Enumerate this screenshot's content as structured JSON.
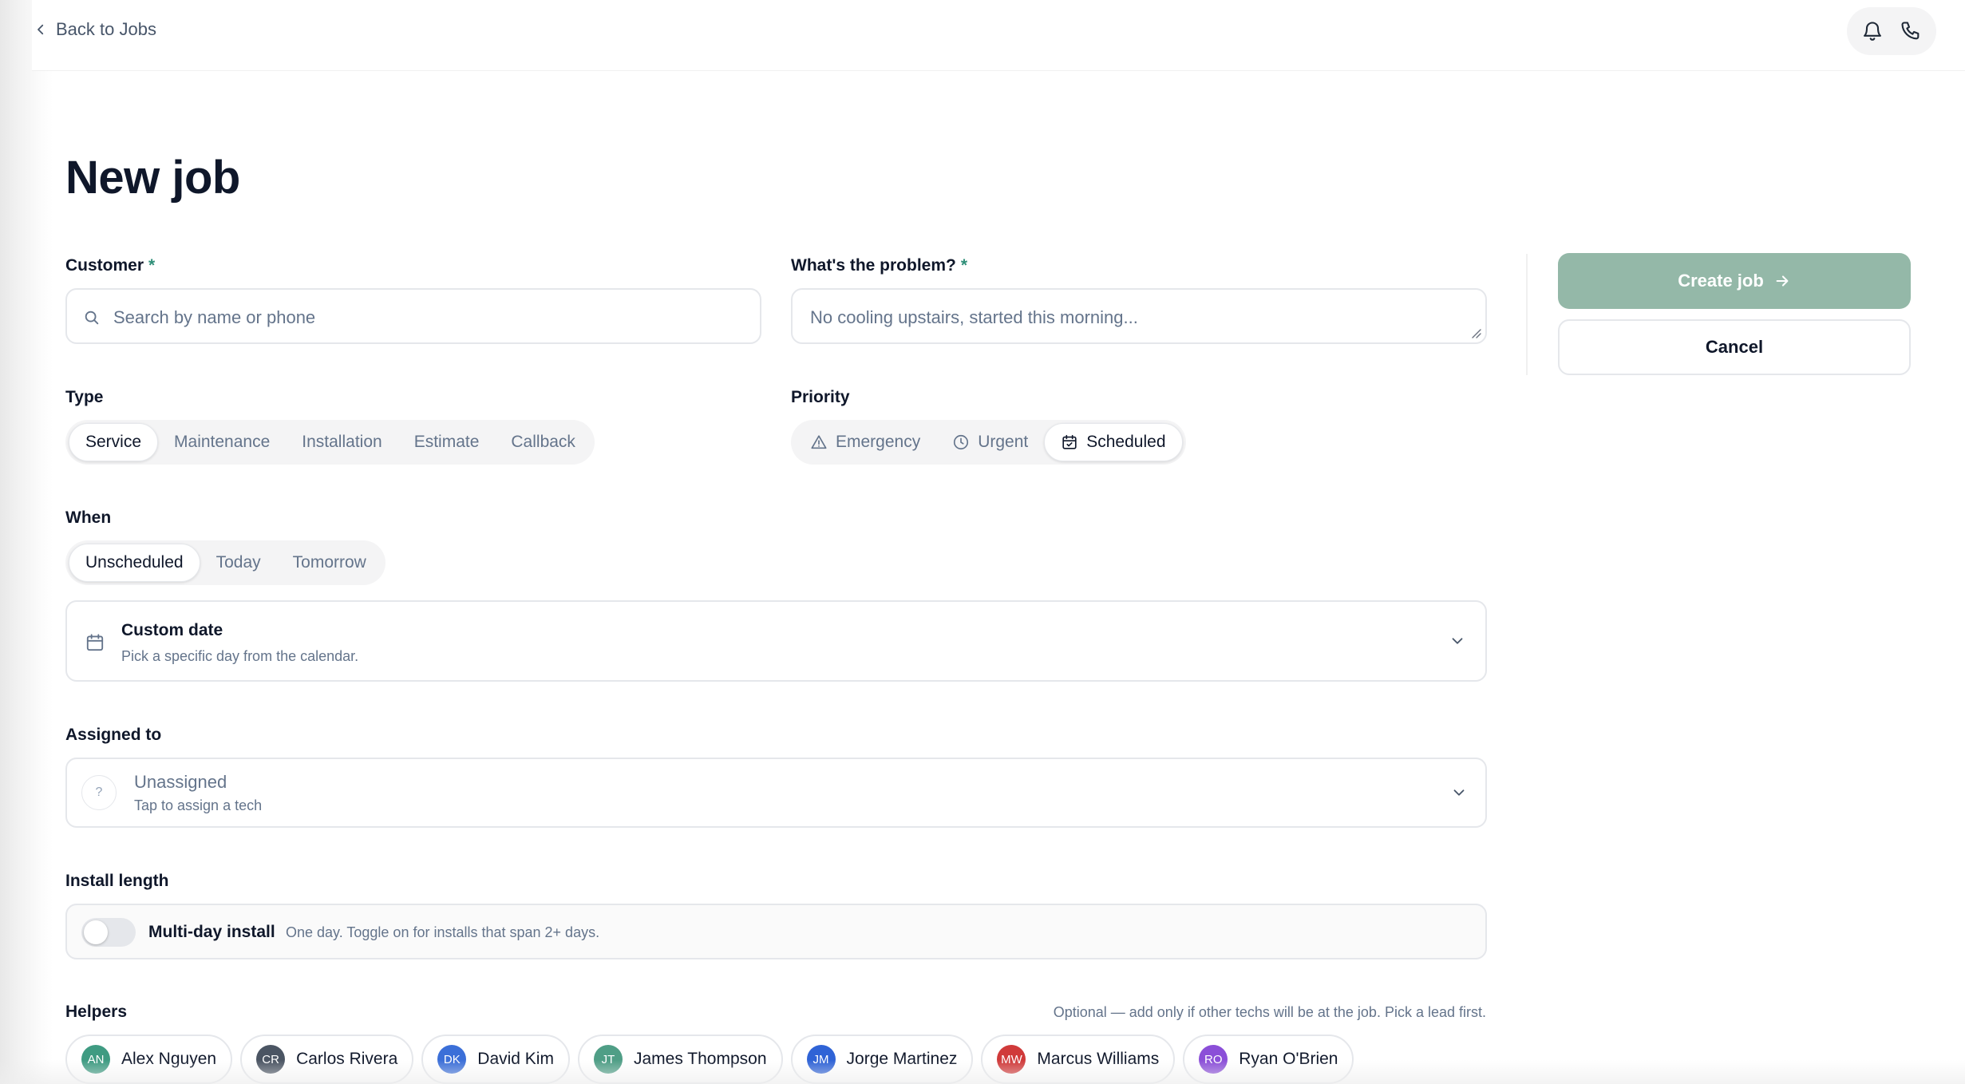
{
  "topbar": {
    "back_label": "Back to Jobs",
    "icons": [
      "chevron-left-icon",
      "bell-icon",
      "phone-icon"
    ]
  },
  "page": {
    "title": "New job"
  },
  "customer": {
    "label": "Customer",
    "required_mark": "*",
    "placeholder": "Search by name or phone"
  },
  "problem": {
    "label": "What's the problem?",
    "required_mark": "*",
    "placeholder": "No cooling upstairs, started this morning..."
  },
  "type": {
    "label": "Type",
    "options": [
      "Service",
      "Maintenance",
      "Installation",
      "Estimate",
      "Callback"
    ],
    "selected": "Service"
  },
  "priority": {
    "label": "Priority",
    "options": [
      "Emergency",
      "Urgent",
      "Scheduled"
    ],
    "selected": "Scheduled"
  },
  "when": {
    "label": "When",
    "options": [
      "Unscheduled",
      "Today",
      "Tomorrow"
    ],
    "selected": "Unscheduled",
    "custom_title": "Custom date",
    "custom_sub": "Pick a specific day from the calendar."
  },
  "assigned": {
    "label": "Assigned to",
    "avatar_mark": "?",
    "value": "Unassigned",
    "sub": "Tap to assign a tech"
  },
  "install": {
    "label": "Install length",
    "toggle_label": "Multi-day install",
    "toggle_on": false,
    "note": "One day. Toggle on for installs that span 2+ days."
  },
  "helpers": {
    "label": "Helpers",
    "note": "Optional — add only if other techs will be at the job. Pick a lead first.",
    "people": [
      {
        "initials": "AN",
        "name": "Alex Nguyen",
        "color": "#3f9b82"
      },
      {
        "initials": "CR",
        "name": "Carlos Rivera",
        "color": "#4b5563"
      },
      {
        "initials": "DK",
        "name": "David Kim",
        "color": "#3b6fd8"
      },
      {
        "initials": "JT",
        "name": "James Thompson",
        "color": "#4f9e86"
      },
      {
        "initials": "JM",
        "name": "Jorge Martinez",
        "color": "#2f63d6"
      },
      {
        "initials": "MW",
        "name": "Marcus Williams",
        "color": "#d03a3a"
      },
      {
        "initials": "RO",
        "name": "Ryan O'Brien",
        "color": "#8b4fd8"
      }
    ]
  },
  "actions": {
    "create_label": "Create job",
    "cancel_label": "Cancel"
  }
}
